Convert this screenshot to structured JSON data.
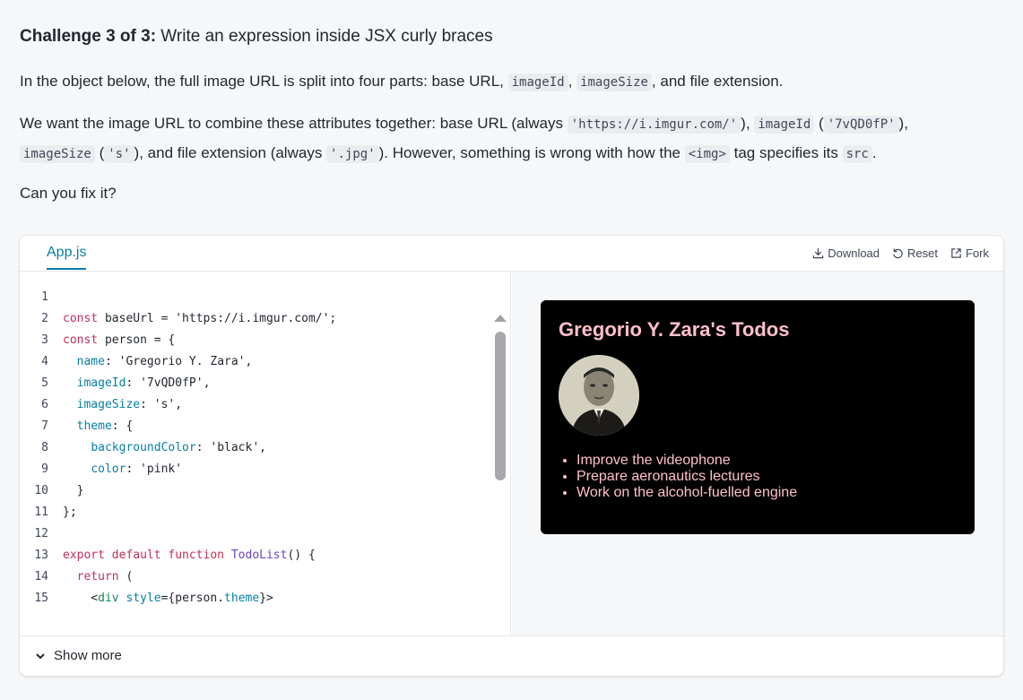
{
  "challenge": {
    "prefix": "Challenge 3 of 3:",
    "title": " Write an expression inside JSX curly braces"
  },
  "para1": {
    "t1": "In the object below, the full image URL is split into four parts: base URL, ",
    "c1": "imageId",
    "t2": ", ",
    "c2": "imageSize",
    "t3": ", and file extension."
  },
  "para2": {
    "t1": "We want the image URL to combine these attributes together: base URL (always ",
    "c1": "'https://i.imgur.com/'",
    "t2": "), ",
    "c2": "imageId",
    "t3": " (",
    "c3": "'7vQD0fP'",
    "t4": "),",
    "c4": "imageSize",
    "t5": " (",
    "c5": "'s'",
    "t6": "), and file extension (always ",
    "c6": "'.jpg'",
    "t7": "). However, something is wrong with how the ",
    "c7": "<img>",
    "t8": " tag specifies its ",
    "c8": "src",
    "t9": "."
  },
  "para3": "Can you fix it?",
  "sandbox": {
    "tab": "App.js",
    "actions": {
      "download": "Download",
      "reset": "Reset",
      "fork": "Fork"
    },
    "show_more": "Show more"
  },
  "code": {
    "lines": [
      {
        "n": "1",
        "parts": []
      },
      {
        "n": "2",
        "parts": [
          [
            "kw",
            "const"
          ],
          [
            "plain",
            " baseUrl = "
          ],
          [
            "str",
            "'https://i.imgur.com/'"
          ],
          [
            "plain",
            ";"
          ]
        ]
      },
      {
        "n": "3",
        "parts": [
          [
            "kw",
            "const"
          ],
          [
            "plain",
            " person = {"
          ]
        ]
      },
      {
        "n": "4",
        "parts": [
          [
            "plain",
            "  "
          ],
          [
            "prop",
            "name"
          ],
          [
            "plain",
            ": "
          ],
          [
            "str",
            "'Gregorio Y. Zara'"
          ],
          [
            "plain",
            ","
          ]
        ]
      },
      {
        "n": "5",
        "parts": [
          [
            "plain",
            "  "
          ],
          [
            "prop",
            "imageId"
          ],
          [
            "plain",
            ": "
          ],
          [
            "str",
            "'7vQD0fP'"
          ],
          [
            "plain",
            ","
          ]
        ]
      },
      {
        "n": "6",
        "parts": [
          [
            "plain",
            "  "
          ],
          [
            "prop",
            "imageSize"
          ],
          [
            "plain",
            ": "
          ],
          [
            "str",
            "'s'"
          ],
          [
            "plain",
            ","
          ]
        ]
      },
      {
        "n": "7",
        "parts": [
          [
            "plain",
            "  "
          ],
          [
            "prop",
            "theme"
          ],
          [
            "plain",
            ": {"
          ]
        ]
      },
      {
        "n": "8",
        "parts": [
          [
            "plain",
            "    "
          ],
          [
            "prop",
            "backgroundColor"
          ],
          [
            "plain",
            ": "
          ],
          [
            "str",
            "'black'"
          ],
          [
            "plain",
            ","
          ]
        ]
      },
      {
        "n": "9",
        "parts": [
          [
            "plain",
            "    "
          ],
          [
            "prop",
            "color"
          ],
          [
            "plain",
            ": "
          ],
          [
            "str",
            "'pink'"
          ]
        ]
      },
      {
        "n": "10",
        "parts": [
          [
            "plain",
            "  }"
          ]
        ]
      },
      {
        "n": "11",
        "parts": [
          [
            "plain",
            "};"
          ]
        ]
      },
      {
        "n": "12",
        "parts": []
      },
      {
        "n": "13",
        "parts": [
          [
            "kw",
            "export default function"
          ],
          [
            "plain",
            " "
          ],
          [
            "fn",
            "TodoList"
          ],
          [
            "plain",
            "() {"
          ]
        ]
      },
      {
        "n": "14",
        "parts": [
          [
            "plain",
            "  "
          ],
          [
            "kw",
            "return"
          ],
          [
            "plain",
            " ("
          ]
        ]
      },
      {
        "n": "15",
        "parts": [
          [
            "plain",
            "    <"
          ],
          [
            "tag",
            "div"
          ],
          [
            "plain",
            " "
          ],
          [
            "prop",
            "style"
          ],
          [
            "plain",
            "={person."
          ],
          [
            "prop",
            "theme"
          ],
          [
            "plain",
            "}>"
          ]
        ]
      }
    ]
  },
  "preview": {
    "heading": "Gregorio Y. Zara's Todos",
    "items": [
      "Improve the videophone",
      "Prepare aeronautics lectures",
      "Work on the alcohol-fuelled engine"
    ],
    "bg": "#000000",
    "fg": "#ffc0cb"
  }
}
